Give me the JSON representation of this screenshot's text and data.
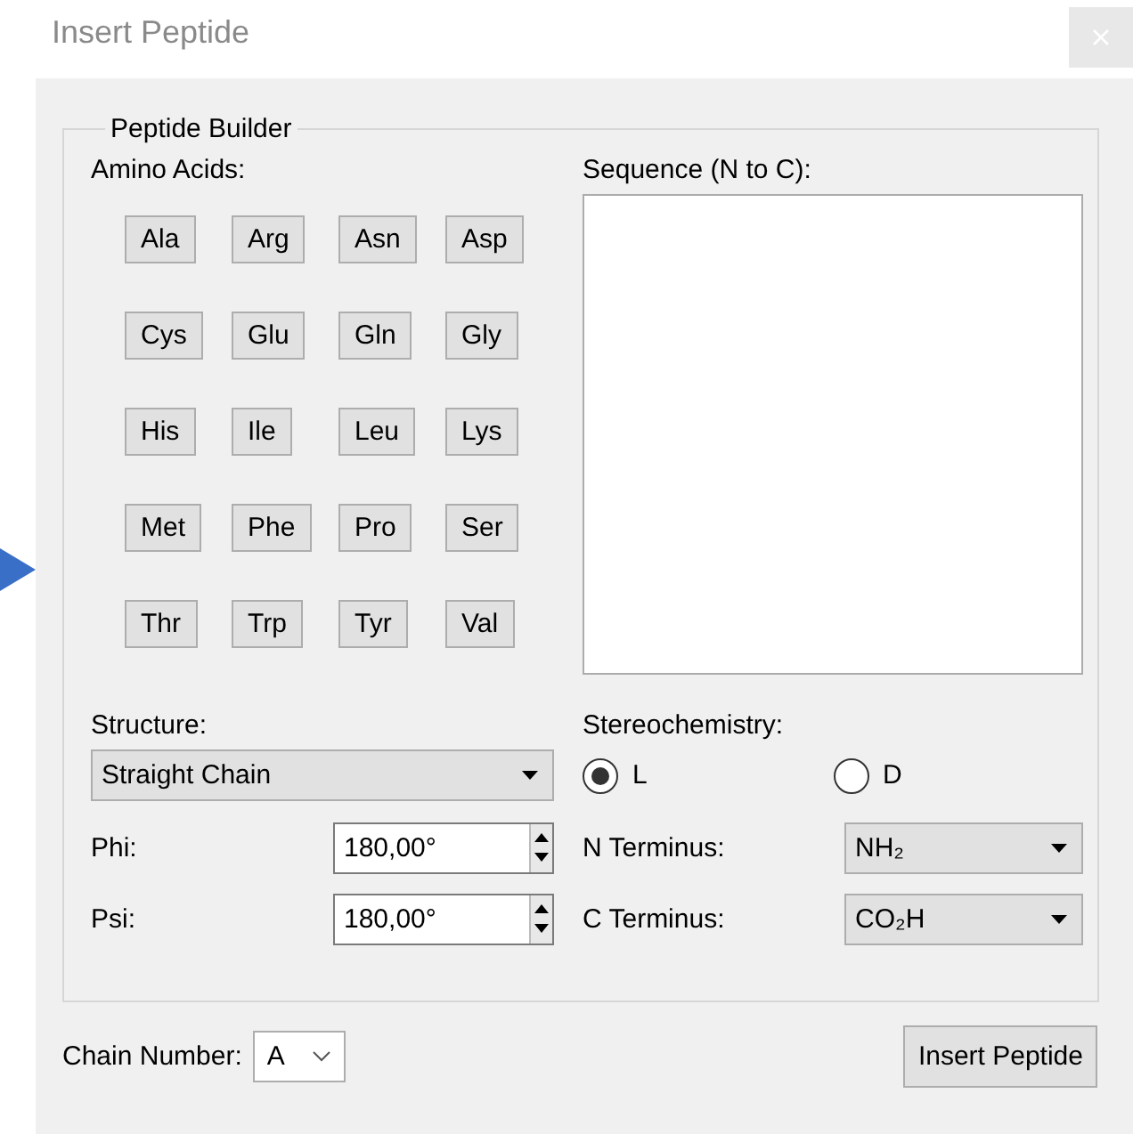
{
  "window": {
    "title": "Insert Peptide"
  },
  "group": {
    "title": "Peptide Builder"
  },
  "amino_acids": {
    "label": "Amino Acids:",
    "buttons": [
      "Ala",
      "Arg",
      "Asn",
      "Asp",
      "Cys",
      "Glu",
      "Gln",
      "Gly",
      "His",
      "Ile",
      "Leu",
      "Lys",
      "Met",
      "Phe",
      "Pro",
      "Ser",
      "Thr",
      "Trp",
      "Tyr",
      "Val"
    ]
  },
  "sequence": {
    "label": "Sequence (N to C):"
  },
  "structure": {
    "label": "Structure:",
    "value": "Straight Chain"
  },
  "phi": {
    "label": "Phi:",
    "value": "180,00°"
  },
  "psi": {
    "label": "Psi:",
    "value": "180,00°"
  },
  "stereochemistry": {
    "label": "Stereochemistry:",
    "options": [
      {
        "label": "L",
        "selected": true
      },
      {
        "label": "D",
        "selected": false
      }
    ]
  },
  "n_terminus": {
    "label": "N Terminus:",
    "value": "NH₂"
  },
  "c_terminus": {
    "label": "C Terminus:",
    "value": "CO₂H"
  },
  "chain_number": {
    "label": "Chain Number:",
    "value": "A"
  },
  "buttons": [
    "Insert Peptide"
  ]
}
